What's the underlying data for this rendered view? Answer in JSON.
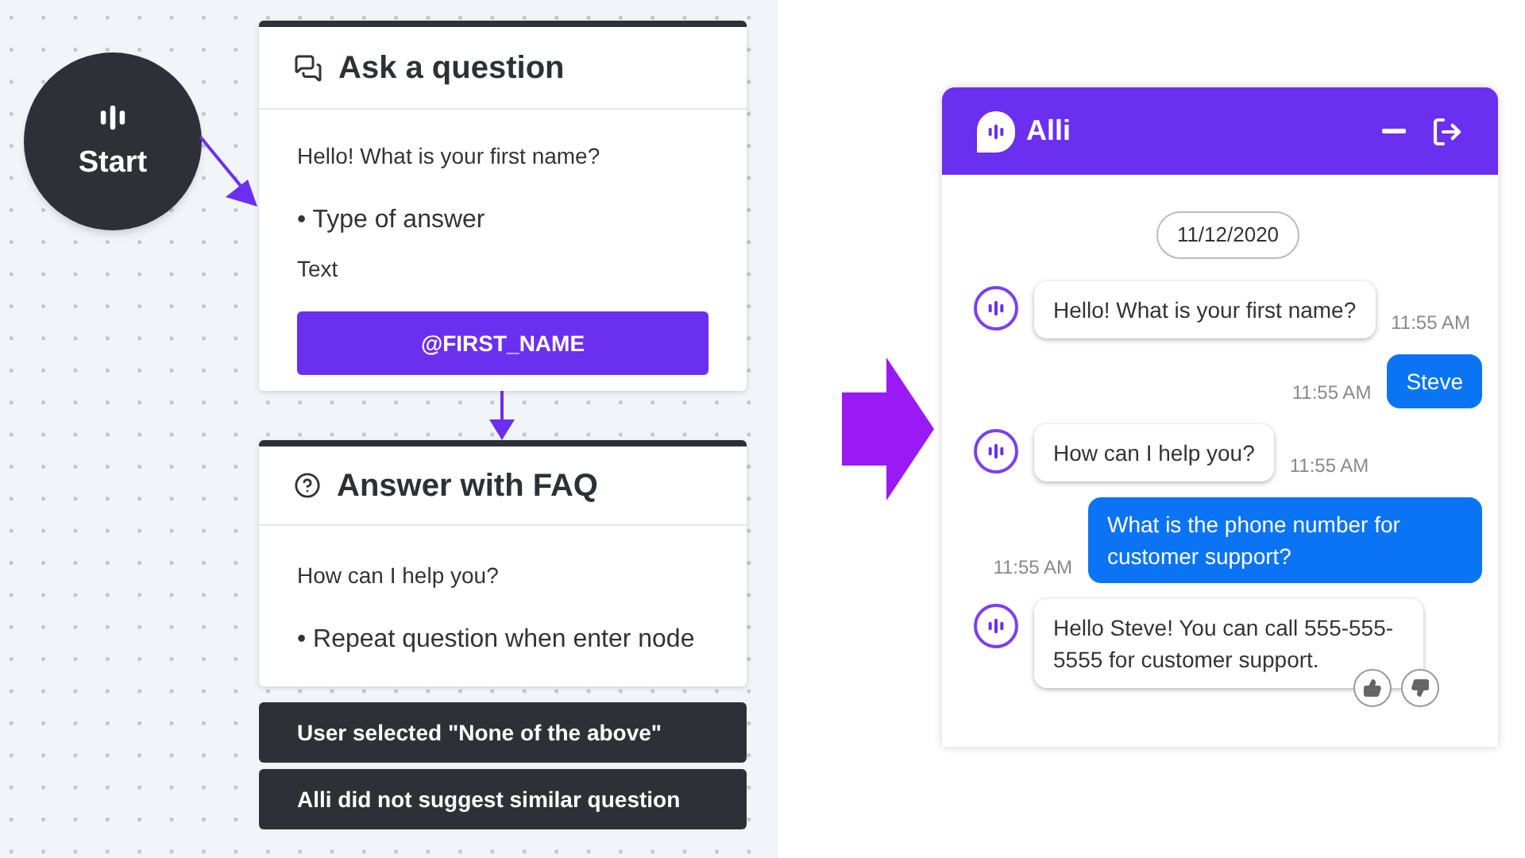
{
  "flow": {
    "start": {
      "label": "Start"
    },
    "ask_node": {
      "title": "Ask a question",
      "question": "Hello! What is your first name?",
      "option": "• Type of answer",
      "answer_type": "Text",
      "variable": "@FIRST_NAME"
    },
    "faq_node": {
      "title": "Answer with FAQ",
      "question": "How can I help you?",
      "option": "• Repeat question when enter node"
    },
    "branches": [
      "User selected \"None of the above\"",
      "Alli did not suggest similar question"
    ]
  },
  "chat": {
    "title": "Alli",
    "date": "11/12/2020",
    "messages": [
      {
        "kind": "bot",
        "text": "Hello! What is your first name?",
        "time": "11:55 AM",
        "feedback": false
      },
      {
        "kind": "user",
        "text": "Steve",
        "time": "11:55 AM"
      },
      {
        "kind": "bot",
        "text": "How can I help you?",
        "time": "11:55 AM",
        "feedback": false
      },
      {
        "kind": "user",
        "text": "What is the phone number for customer support?",
        "time": "11:55 AM"
      },
      {
        "kind": "bot",
        "text": "Hello Steve! You can call 555-555-5555 for customer support.",
        "feedback": true
      }
    ]
  }
}
